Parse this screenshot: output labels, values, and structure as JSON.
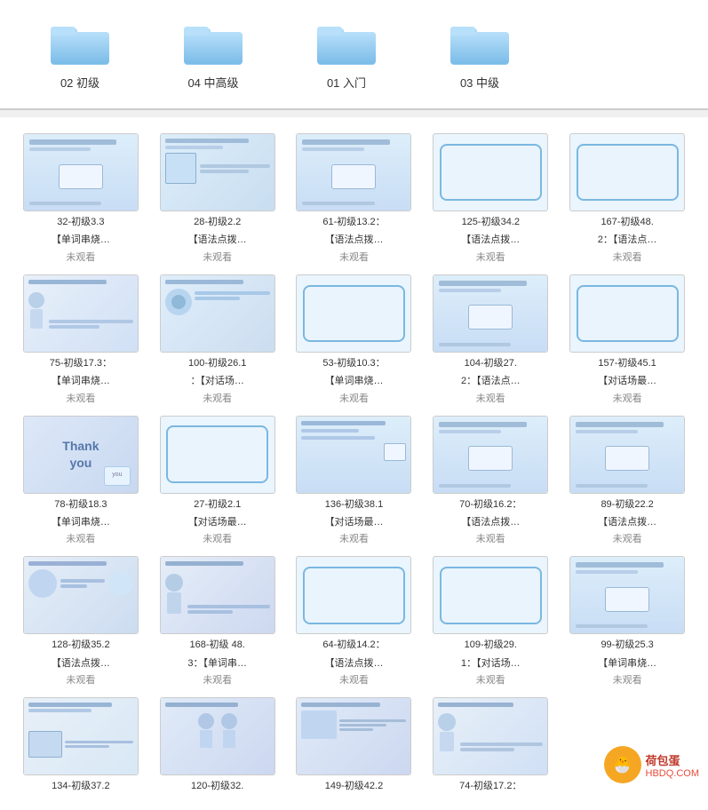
{
  "folders": [
    {
      "id": "folder-1",
      "label": "02 初级"
    },
    {
      "id": "folder-2",
      "label": "04 中高级"
    },
    {
      "id": "folder-3",
      "label": "01 入门"
    },
    {
      "id": "folder-4",
      "label": "03 中级"
    }
  ],
  "videos": [
    {
      "id": "v1",
      "title": "32-初级3.3",
      "subtitle": "【单词串烧…",
      "status": "未观看",
      "thumb": "content"
    },
    {
      "id": "v2",
      "title": "28-初级2.2",
      "subtitle": "【语法点拨…",
      "status": "未观看",
      "thumb": "content2"
    },
    {
      "id": "v3",
      "title": "61-初级13.2：",
      "subtitle": "【语法点拨…",
      "status": "未观看",
      "thumb": "content"
    },
    {
      "id": "v4",
      "title": "125-初级34.2",
      "subtitle": "【语法点拨…",
      "status": "未观看",
      "thumb": "outline"
    },
    {
      "id": "v5",
      "title": "167-初级48.",
      "subtitle": "2：【语法点…",
      "status": "未观看",
      "thumb": "outline"
    },
    {
      "id": "v6",
      "title": "75-初级17.3：",
      "subtitle": "【单词串烧…",
      "status": "未观看",
      "thumb": "person"
    },
    {
      "id": "v7",
      "title": "100-初级26.1",
      "subtitle": "：【对话场…",
      "status": "未观看",
      "thumb": "content3"
    },
    {
      "id": "v8",
      "title": "53-初级10.3：",
      "subtitle": "【单词串烧…",
      "status": "未观看",
      "thumb": "outline"
    },
    {
      "id": "v9",
      "title": "104-初级27.",
      "subtitle": "2：【语法点…",
      "status": "未观看",
      "thumb": "content"
    },
    {
      "id": "v10",
      "title": "157-初级45.1",
      "subtitle": "【对话场最…",
      "status": "未观看",
      "thumb": "outline"
    },
    {
      "id": "v11",
      "title": "78-初级18.3",
      "subtitle": "【单词串烧…",
      "status": "未观看",
      "thumb": "thankyou"
    },
    {
      "id": "v12",
      "title": "27-初级2.1",
      "subtitle": "【对话场最…",
      "status": "未观看",
      "thumb": "outline"
    },
    {
      "id": "v13",
      "title": "136-初级38.1",
      "subtitle": "【对话场最…",
      "status": "未观看",
      "thumb": "content4"
    },
    {
      "id": "v14",
      "title": "70-初级16.2：",
      "subtitle": "【语法点拨…",
      "status": "未观看",
      "thumb": "content"
    },
    {
      "id": "v15",
      "title": "89-初级22.2",
      "subtitle": "【语法点拨…",
      "status": "未观看",
      "thumb": "content"
    },
    {
      "id": "v16",
      "title": "128-初级35.2",
      "subtitle": "【语法点拨…",
      "status": "未观看",
      "thumb": "content5"
    },
    {
      "id": "v17",
      "title": "168-初级 48.",
      "subtitle": "3：【单词串…",
      "status": "未观看",
      "thumb": "person2"
    },
    {
      "id": "v18",
      "title": "64-初级14.2：",
      "subtitle": "【语法点拨…",
      "status": "未观看",
      "thumb": "outline"
    },
    {
      "id": "v19",
      "title": "109-初级29.",
      "subtitle": "1：【对话场…",
      "status": "未观看",
      "thumb": "outline"
    },
    {
      "id": "v20",
      "title": "99-初级25.3",
      "subtitle": "【单词串烧…",
      "status": "未观看",
      "thumb": "content"
    },
    {
      "id": "v21",
      "title": "134-初级37.2",
      "subtitle": "",
      "status": "",
      "thumb": "content6"
    },
    {
      "id": "v22",
      "title": "120-初级32.",
      "subtitle": "",
      "status": "",
      "thumb": "person3"
    },
    {
      "id": "v23",
      "title": "149-初级42.2",
      "subtitle": "",
      "status": "",
      "thumb": "content7"
    },
    {
      "id": "v24",
      "title": "74-初级17.2：",
      "subtitle": "",
      "status": "",
      "thumb": "person4"
    }
  ],
  "watermark": {
    "icon": "🐣",
    "text": "荷包蛋",
    "url_text": "HBDQ.COM"
  }
}
